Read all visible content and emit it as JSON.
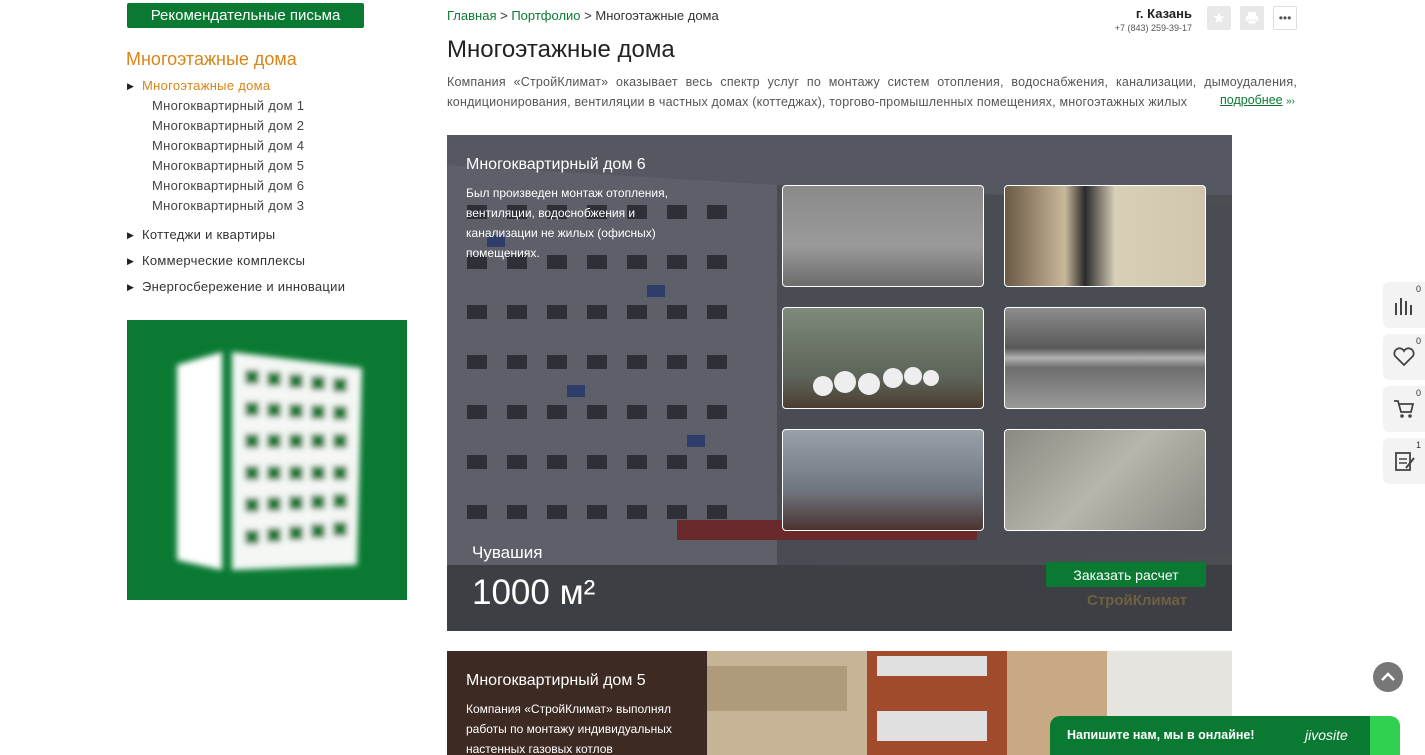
{
  "left": {
    "rec_button": "Рекомендательные письма",
    "section_title": "Многоэтажные дома",
    "menu": {
      "active": "Многоэтажные дома",
      "subitems": [
        "Многоквартирный дом 1",
        "Многоквартирный дом 2",
        "Многоквартирный дом 4",
        "Многоквартирный дом 5",
        "Многоквартирный дом 6",
        "Многоквартирный дом 3"
      ],
      "others": [
        "Коттеджи и квартиры",
        "Коммерческие комплексы",
        "Энергосбережение и инновации"
      ]
    }
  },
  "header": {
    "breadcrumbs": {
      "home": "Главная",
      "sep": ">",
      "portfolio": "Портфолио",
      "current": "Многоэтажные дома"
    },
    "city": "г. Казань",
    "phone": "+7 (843) 259-39-17",
    "icons": [
      "star-icon",
      "print-icon",
      "more-icon"
    ]
  },
  "main": {
    "title": "Многоэтажные дома",
    "intro_line1": "Компания «СтройКлимат» оказывает весь спектр услуг по монтажу систем отопления, водоснабжения, канализации, дымоудаления,",
    "intro_line2": "кондиционирования, вентиляции в частных домах (коттеджах), торгово-промышленных помещениях, многоэтажных жилых",
    "more_link": "подробнее",
    "more_arrow": "»›"
  },
  "cards": [
    {
      "title": "Многоквартирный дом 6",
      "description": "Был произведен монтаж отопления, вентиляции, водоснобжения и канализации не жилых (офисных) помещениях.",
      "region": "Чувашия",
      "area": "1000 м²",
      "order_button": "Заказать расчет",
      "watermark": "СтройКлимат"
    },
    {
      "title": "Многоквартирный дом 5",
      "description": "Компания «СтройКлимат» выполнял работы по монтажу индивидуальных настенных газовых котлов"
    }
  ],
  "widgets": {
    "compare_count": "0",
    "favorites_count": "0",
    "cart_count": "0",
    "orders_count": "1",
    "chat_text": "Напишите нам, мы в онлайне!",
    "chat_brand": "jivosite"
  },
  "colors": {
    "brand_green": "#0a7a33",
    "accent_orange": "#d98419"
  }
}
